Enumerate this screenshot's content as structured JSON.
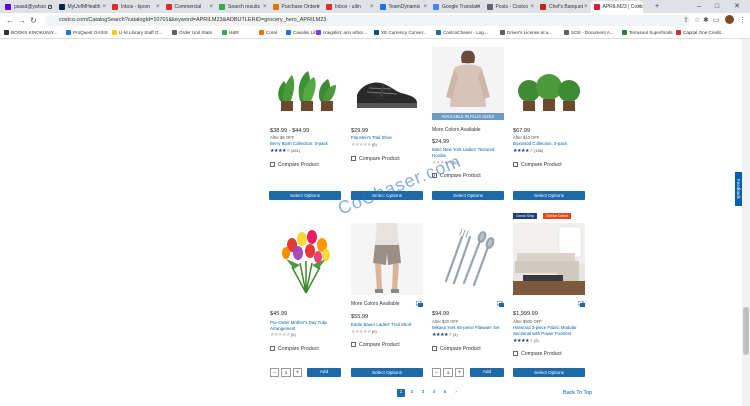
{
  "browser": {
    "tabs": [
      {
        "label": "psasd@yahoo",
        "color": "#6001d2"
      },
      {
        "label": "MyUofMHealth",
        "color": "#00274c"
      },
      {
        "label": "Inbox - kpom",
        "color": "#d93025"
      },
      {
        "label": "Commercial",
        "color": "#d93025"
      },
      {
        "label": "Search results",
        "color": "#34a853"
      },
      {
        "label": "Purchase Orders",
        "color": "#e37400"
      },
      {
        "label": "Inbox - utlin",
        "color": "#d93025"
      },
      {
        "label": "TeamDynamix",
        "color": "#1a73e8"
      },
      {
        "label": "Google Translate",
        "color": "#4285f4"
      },
      {
        "label": "Posts - Costco",
        "color": "#5f6368"
      },
      {
        "label": "Chef's Banquet",
        "color": "#c5221f"
      },
      {
        "label": "APRILM23 | Costco",
        "color": "#e31837"
      }
    ],
    "url": "costco.com/CatalogSearch?catalogId=10701&keyword=APRILM23&ADBUTLERID=grocery_hero_APRILM23",
    "bookmarks": [
      {
        "label": "BOOKS KINOKUNIY...",
        "color": "#333333"
      },
      {
        "label": "ProQuest OASIS",
        "color": "#1a73e8"
      },
      {
        "label": "U-M Library Staff O...",
        "color": "#ffcb05"
      },
      {
        "label": "Order Unit Stats",
        "color": "#5f6368"
      },
      {
        "label": "H&R",
        "color": "#34a853"
      },
      {
        "label": "Coral",
        "color": "#e8710a"
      },
      {
        "label": "Cavalini Libri",
        "color": "#1a73e8"
      },
      {
        "label": "craigslist: ann arbor...",
        "color": "#7c3aed"
      },
      {
        "label": "XE Currency Conver...",
        "color": "#0f4c81"
      },
      {
        "label": "CostcoChaser - Log...",
        "color": "#1e69a8"
      },
      {
        "label": "Driver's License at a...",
        "color": "#5f6368"
      },
      {
        "label": "SOS - Document A...",
        "color": "#5f6368"
      },
      {
        "label": "Terrasoul Superfoods",
        "color": "#2e7d32"
      },
      {
        "label": "Capital One Credit...",
        "color": "#d03027"
      }
    ],
    "feedback_label": "Feedback"
  },
  "products": [
    {
      "price": "$38.99 - $44.99",
      "after": "After $6 OFF",
      "name": "Berry Bush Collection, 3-pack",
      "stars": 4,
      "reviews": "(461)",
      "compare": "Compare Product",
      "button": "Select Options"
    },
    {
      "price": "$29.99",
      "after": "",
      "name": "Fila Men's Trail Shoe",
      "stars": 0,
      "reviews": "(0)",
      "compare": "Compare Product",
      "button": "Select Options"
    },
    {
      "price": "$24.99",
      "after": "",
      "name": "Marc New York Ladies' Textured Hoodie",
      "stars": 0,
      "reviews": "(0)",
      "compare": "Compare Product",
      "button": "Select Options",
      "more_colors": "More Colors Available",
      "badge": "AVAILABLE IN PLUS SIZES"
    },
    {
      "price": "$67.99",
      "after": "After $10 OFF",
      "name": "Boxwood Collection, 3-pack",
      "stars": 4,
      "reviews": "(136)",
      "compare": "Compare Product",
      "button": "Select Options"
    },
    {
      "price": "$45.99",
      "after": "",
      "name": "Pre-Order Mother's Day Tulip Arrangement",
      "stars": 0,
      "reviews": "(0)",
      "compare": "Compare Product",
      "qty": "1",
      "button": "Add"
    },
    {
      "price": "$55.99",
      "after": "",
      "name": "Eddie Bauer Ladies' Trail Short",
      "stars": 0,
      "reviews": "(0)",
      "compare": "Compare Product",
      "button": "Select Options",
      "more_colors": "More Colors Available"
    },
    {
      "price": "$94.99",
      "after": "After $20 OFF",
      "name": "Mikasa York 65-piece Flatware Set",
      "stars": 4,
      "reviews": "(4)",
      "compare": "Compare Product",
      "qty": "1",
      "button": "Add"
    },
    {
      "price": "$1,999.99",
      "after": "After $500 OFF",
      "name": "Harwood 3-piece Fabric Modular Sectional with Power Footrest",
      "stars": 4,
      "reviews": "(2)",
      "compare": "Compare Product",
      "button": "Select Options",
      "tags": [
        "Great Ship",
        "Online Direct"
      ]
    }
  ],
  "pagination": {
    "pages": [
      "1",
      "2",
      "3",
      "4",
      "5"
    ],
    "current": "1",
    "next": "›"
  },
  "back_to_top": "Back To Top",
  "watermark": "CoChaser.com"
}
